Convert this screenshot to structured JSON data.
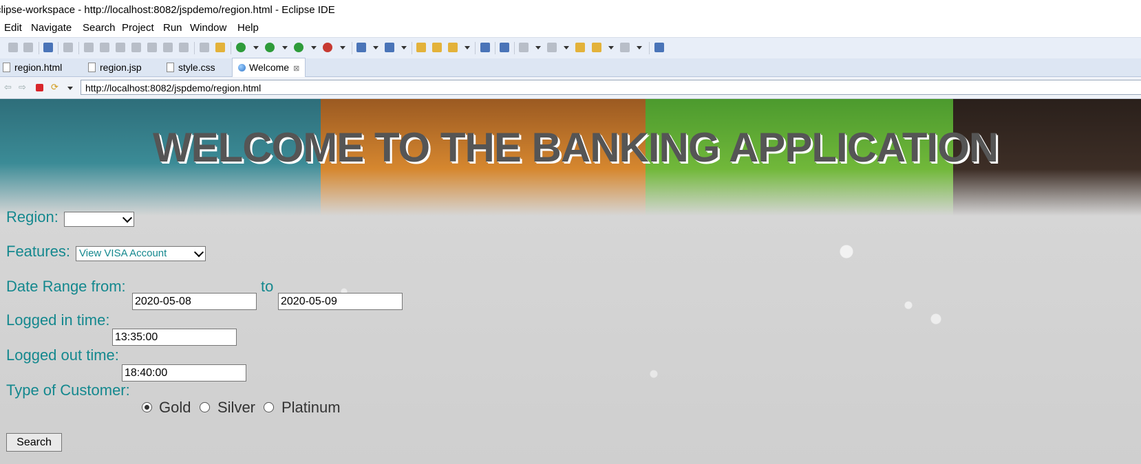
{
  "window": {
    "title": "clipse-workspace - http://localhost:8082/jspdemo/region.html - Eclipse IDE"
  },
  "menu": {
    "items": [
      "Edit",
      "Navigate",
      "Search",
      "Project",
      "Run",
      "Window",
      "Help"
    ]
  },
  "tabs": [
    {
      "label": "region.html",
      "active": false
    },
    {
      "label": "region.jsp",
      "active": false
    },
    {
      "label": "style.css",
      "active": false
    },
    {
      "label": "Welcome",
      "active": true
    }
  ],
  "browser": {
    "url": "http://localhost:8082/jspdemo/region.html"
  },
  "page": {
    "heading": "WELCOME TO THE BANKING APPLICATION",
    "region": {
      "label": "Region:",
      "value": ""
    },
    "features": {
      "label": "Features:",
      "value": "View VISA Account"
    },
    "date_range": {
      "label": "Date Range from:",
      "from": "2020-05-08",
      "to_label": "to",
      "to": "2020-05-09"
    },
    "logged_in": {
      "label": "Logged in time:",
      "value": "13:35:00"
    },
    "logged_out": {
      "label": "Logged out time:",
      "value": "18:40:00"
    },
    "customer_type": {
      "label": "Type of Customer:",
      "options": [
        "Gold",
        "Silver",
        "Platinum"
      ],
      "selected": "Gold"
    },
    "search_button": "Search"
  },
  "colors": {
    "label": "#14888e",
    "banner_teal": "#3b8b96",
    "banner_orange": "#d6872f",
    "banner_green": "#71b83a",
    "banner_brown": "#3d2e26"
  }
}
